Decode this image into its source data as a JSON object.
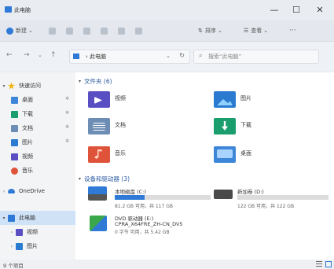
{
  "window": {
    "title": "此电脑"
  },
  "window_buttons": {
    "minimize": "—",
    "maximize": "☐",
    "close": "✕"
  },
  "toolbar": {
    "new": "新建",
    "sort": "排序",
    "view": "查看",
    "more": "···"
  },
  "nav": {
    "back": "←",
    "forward": "→",
    "up": "↑"
  },
  "address": {
    "path": "此电脑",
    "chevron": "⌄",
    "refresh": "↻"
  },
  "search": {
    "placeholder": "搜索“此电脑”",
    "icon": "⌕"
  },
  "sidebar": {
    "items": [
      {
        "label": "快速访问",
        "icon": "star-icon",
        "color": "#f0b400",
        "pinned": false
      },
      {
        "label": "桌面",
        "icon": "desktop-icon",
        "color": "#3d86d8",
        "pinned": true
      },
      {
        "label": "下载",
        "icon": "download-icon",
        "color": "#1a9e6e",
        "pinned": true
      },
      {
        "label": "文档",
        "icon": "document-icon",
        "color": "#6d8db5",
        "pinned": true
      },
      {
        "label": "图片",
        "icon": "picture-icon",
        "color": "#2a7bd0",
        "pinned": true
      },
      {
        "label": "视频",
        "icon": "video-icon",
        "color": "#5a4fc2",
        "pinned": false
      },
      {
        "label": "音乐",
        "icon": "music-icon",
        "color": "#e0533b",
        "pinned": false
      },
      {
        "label": "OneDrive",
        "icon": "cloud-icon",
        "color": "#2f7ad6",
        "pinned": false
      },
      {
        "label": "此电脑",
        "icon": "pc-icon",
        "color": "#2f7ad6",
        "pinned": false,
        "selected": true
      },
      {
        "label": "视频",
        "icon": "video-icon",
        "color": "#5a4fc2",
        "pinned": false
      },
      {
        "label": "图片",
        "icon": "picture-icon",
        "color": "#2a7bd0",
        "pinned": false
      }
    ]
  },
  "folders_section": {
    "title": "文件夹 (6)",
    "items": [
      {
        "label": "视频",
        "icon": "video-folder-icon",
        "color": "#5a4fc2"
      },
      {
        "label": "图片",
        "icon": "picture-folder-icon",
        "color": "#2a7bd0"
      },
      {
        "label": "文档",
        "icon": "document-folder-icon",
        "color": "#6d8db5"
      },
      {
        "label": "下载",
        "icon": "download-folder-icon",
        "color": "#1a9e6e"
      },
      {
        "label": "音乐",
        "icon": "music-folder-icon",
        "color": "#e0533b"
      },
      {
        "label": "桌面",
        "icon": "desktop-folder-icon",
        "color": "#3d86d8"
      }
    ]
  },
  "drives_section": {
    "title": "设备和驱动器 (3)",
    "drives": [
      {
        "name": "本地磁盘 (C:)",
        "free_text": "81.2 GB 可用，共 117 GB",
        "used_fraction": 0.31,
        "icon": "windows-drive-icon"
      },
      {
        "name": "新加卷 (D:)",
        "free_text": "122 GB 可用，共 122 GB",
        "used_fraction": 0.0,
        "icon": "drive-icon"
      },
      {
        "name": "DVD 驱动器 (E:)",
        "volume": "CPRA_X64FRE_ZH-CN_DV5",
        "free_text": "0 字节 可用，共 5.42 GB",
        "icon": "dvd-drive-icon"
      }
    ]
  },
  "status": {
    "count": "9 个项目"
  },
  "colors": {
    "accent": "#2f7ad6",
    "selection": "#cfe2f6",
    "bar_track": "#dcdcdc"
  }
}
